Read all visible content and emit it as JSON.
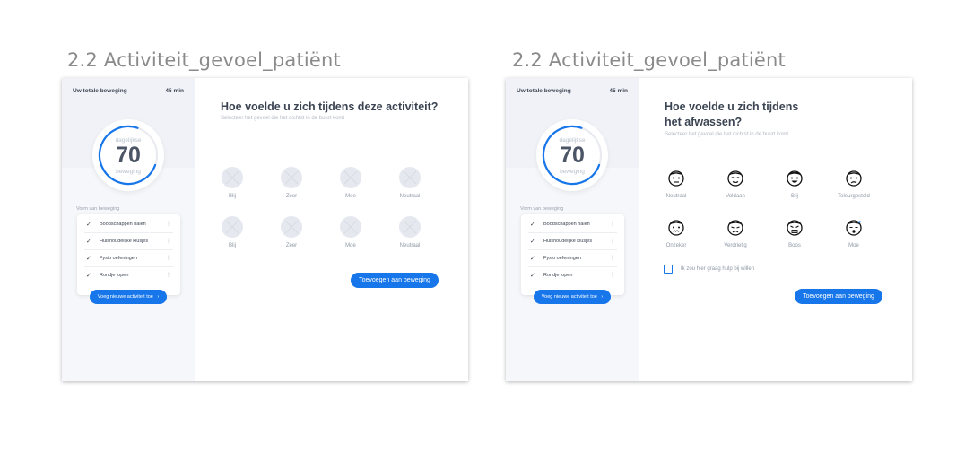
{
  "artboards": [
    {
      "title": "2.2 Activiteit_gevoel_patiënt",
      "sidebar": {
        "heading": "Uw totale beweging",
        "minutes": "45 min",
        "ring": {
          "top_label": "dagelijkse",
          "value": "70",
          "bottom_label": "beweging"
        },
        "list_label": "Vorm van beweging",
        "activities": [
          "Boodschappen halen",
          "Huishoudelijke klusjes",
          "Fysio oefeningen",
          "Rondje lopen"
        ],
        "add_button": "Voeg nieuwe activiteit toe"
      },
      "main": {
        "title_lines": [
          "Hoe voelde u zich tijdens deze activiteit?"
        ],
        "subtitle": "Selecteer het gevoel die het dichtst in de buurt komt",
        "emotions": [
          "Blij",
          "Zeer",
          "Moe",
          "Neutraal",
          "Blij",
          "Zeer",
          "Moe",
          "Neutraal"
        ],
        "submit": "Toevoegen aan beweging"
      }
    },
    {
      "title": "2.2 Activiteit_gevoel_patiënt",
      "sidebar": {
        "heading": "Uw totale beweging",
        "minutes": "45 min",
        "ring": {
          "top_label": "dagelijkse",
          "value": "70",
          "bottom_label": "beweging"
        },
        "list_label": "Vorm van beweging",
        "activities": [
          "Boodschappen halen",
          "Huishoudelijke klusjes",
          "Fysio oefeningen",
          "Rondje lopen"
        ],
        "add_button": "Voeg nieuwe activiteit toe"
      },
      "main": {
        "title_lines": [
          "Hoe voelde u zich tijdens",
          "het afwassen?"
        ],
        "subtitle": "Selecteer het gevoel die het dichtst in de buurt komt",
        "emotions": [
          "Neutraal",
          "Voldaan",
          "Blij",
          "Teleurgesteld",
          "Onzeker",
          "Verdrietig",
          "Boos",
          "Moe"
        ],
        "help_checkbox": "Ik zou hier graag hulp bij willen",
        "submit": "Toevoegen aan beweging"
      }
    }
  ],
  "colors": {
    "accent": "#1676ea",
    "sidebar_bg": "#f1f2f7",
    "text_dark": "#3b4452"
  },
  "icons": {
    "check": "check-icon",
    "more": "more-vertical-icon",
    "chevron": "chevron-right-icon",
    "face": "face-icon"
  }
}
